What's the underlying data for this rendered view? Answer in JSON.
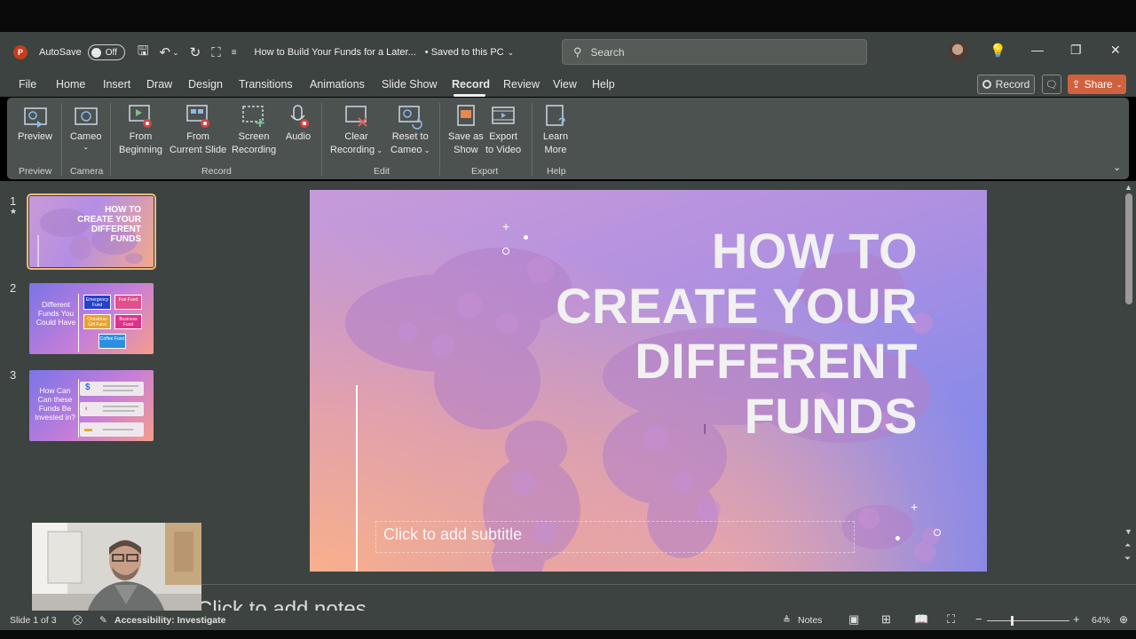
{
  "titlebar": {
    "autosave_label": "AutoSave",
    "autosave_state": "Off",
    "doc_title": "How to Build Your Funds for a Later...",
    "save_status": "• Saved to this PC",
    "search_placeholder": "Search"
  },
  "menu": {
    "items": [
      "File",
      "Home",
      "Insert",
      "Draw",
      "Design",
      "Transitions",
      "Animations",
      "Slide Show",
      "Record",
      "Review",
      "View",
      "Help"
    ],
    "active": "Record",
    "record_button": "Record",
    "share_button": "Share"
  },
  "ribbon": {
    "buttons": {
      "preview": "Preview",
      "cameo": "Cameo",
      "from_beginning_1": "From",
      "from_beginning_2": "Beginning",
      "from_current_1": "From",
      "from_current_2": "Current Slide",
      "screen_rec_1": "Screen",
      "screen_rec_2": "Recording",
      "audio": "Audio",
      "clear_rec_1": "Clear",
      "clear_rec_2": "Recording",
      "reset_cameo_1": "Reset to",
      "reset_cameo_2": "Cameo",
      "save_show_1": "Save as",
      "save_show_2": "Show",
      "export_video_1": "Export",
      "export_video_2": "to Video",
      "learn_more_1": "Learn",
      "learn_more_2": "More"
    },
    "groups": {
      "preview": "Preview",
      "camera": "Camera",
      "record": "Record",
      "edit": "Edit",
      "export": "Export",
      "help": "Help"
    }
  },
  "thumbnails": {
    "numbers": [
      "1",
      "2",
      "3"
    ],
    "slide1_title": "HOW TO CREATE YOUR DIFFERENT FUNDS",
    "slide2_title": "Different Funds You Could Have",
    "slide2_boxes": [
      "Emergency Fund",
      "Fun Fund",
      "Christmas Gift Fund",
      "Business Fund",
      "Coffee Fund"
    ],
    "slide3_title": "How Can Can these Funds Be Invested in?"
  },
  "slide": {
    "title_lines": [
      "HOW TO",
      "CREATE YOUR",
      "DIFFERENT",
      "FUNDS"
    ],
    "subtitle_placeholder": "Click to add subtitle"
  },
  "notes": {
    "placeholder": "Click to add notes"
  },
  "status": {
    "slide_counter": "Slide 1 of 3",
    "accessibility": "Accessibility: Investigate",
    "notes_label": "Notes",
    "zoom_percent": "64%",
    "zoom_level": 0.64
  },
  "colors": {
    "chrome_bg": "#3d4340",
    "ribbon_bg": "#4c524f",
    "share_accent": "#d0613f",
    "selection_outline": "#f0b97b"
  }
}
